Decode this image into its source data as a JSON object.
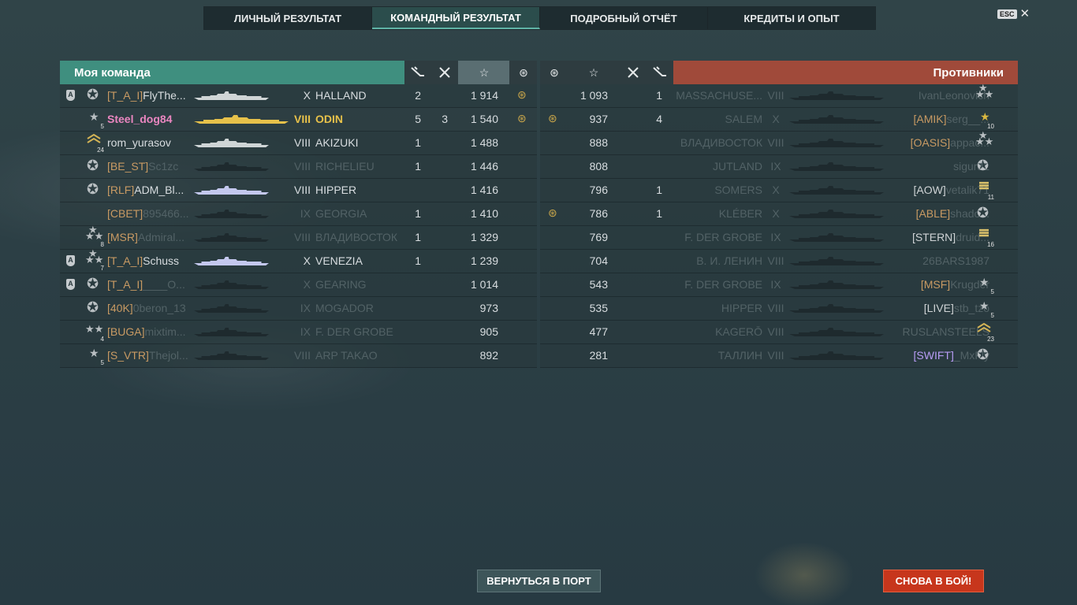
{
  "tabs": [
    "ЛИЧНЫЙ РЕЗУЛЬТАТ",
    "КОМАНДНЫЙ РЕЗУЛЬТАТ",
    "ПОДРОБНЫЙ ОТЧЁТ",
    "КРЕДИТЫ И ОПЫТ"
  ],
  "active_tab": 1,
  "esc": {
    "key": "ESC",
    "close": "✕"
  },
  "my_team": {
    "title": "Моя команда",
    "rows": [
      {
        "a": true,
        "rank": "",
        "rank_style": "big",
        "clan": "[T_A_I]",
        "name": "FlyThe...",
        "tier": "X",
        "ship": "HALLAND",
        "c1": "2",
        "c2": "",
        "xp": "1 914",
        "honor": true,
        "dead": false,
        "sil": "#cfd5d6"
      },
      {
        "a": false,
        "rank": "5",
        "rank_style": "small",
        "clan": "",
        "name": "Steel_dog84",
        "tier": "VIII",
        "ship": "ODIN",
        "c1": "5",
        "c2": "3",
        "xp": "1 540",
        "honor": true,
        "dead": false,
        "me": true,
        "sil": "#e7c14a"
      },
      {
        "a": false,
        "rank": "24",
        "rank_style": "chev",
        "clan": "",
        "name": "rom_yurasov",
        "tier": "VIII",
        "ship": "AKIZUKI",
        "c1": "1",
        "c2": "",
        "xp": "1 488",
        "honor": false,
        "dead": false,
        "sil": "#cfd5d6"
      },
      {
        "a": false,
        "rank": "",
        "rank_style": "big",
        "clan": "[BE_ST]",
        "name": "Sc1zc",
        "tier": "VIII",
        "ship": "RICHELIEU",
        "c1": "1",
        "c2": "",
        "xp": "1 446",
        "honor": false,
        "dead": true,
        "sil": "#1e2a2e"
      },
      {
        "a": false,
        "rank": "",
        "rank_style": "big",
        "clan": "[RLF]",
        "name": "ADM_Bl...",
        "tier": "VIII",
        "ship": "HIPPER",
        "c1": "",
        "c2": "",
        "xp": "1 416",
        "honor": false,
        "dead": false,
        "sil": "#c4c8ee"
      },
      {
        "a": false,
        "rank": "",
        "rank_style": "none",
        "clan": "[CBET]",
        "name": "895466...",
        "tier": "IX",
        "ship": "GEORGIA",
        "c1": "1",
        "c2": "",
        "xp": "1 410",
        "honor": false,
        "dead": true,
        "sil": "#1e2a2e"
      },
      {
        "a": false,
        "rank": "8",
        "rank_style": "multi",
        "clan": "[MSR]",
        "name": "Admiral...",
        "tier": "VIII",
        "ship": "ВЛАДИВОСТОК",
        "c1": "1",
        "c2": "",
        "xp": "1 329",
        "honor": false,
        "dead": true,
        "sil": "#1e2a2e"
      },
      {
        "a": true,
        "rank": "7",
        "rank_style": "multi",
        "clan": "[T_A_I]",
        "name": "Schuss",
        "tier": "X",
        "ship": "VENEZIA",
        "c1": "1",
        "c2": "",
        "xp": "1 239",
        "honor": false,
        "dead": false,
        "sil": "#c4c8ee"
      },
      {
        "a": true,
        "rank": "",
        "rank_style": "big",
        "clan": "[T_A_I]",
        "name": "____O...",
        "tier": "X",
        "ship": "GEARING",
        "c1": "",
        "c2": "",
        "xp": "1 014",
        "honor": false,
        "dead": true,
        "sil": "#1e2a2e"
      },
      {
        "a": false,
        "rank": "",
        "rank_style": "big",
        "clan": "[40K]",
        "name": "0beron_13",
        "tier": "IX",
        "ship": "MOGADOR",
        "c1": "",
        "c2": "",
        "xp": "973",
        "honor": false,
        "dead": true,
        "sil": "#1e2a2e"
      },
      {
        "a": false,
        "rank": "4",
        "rank_style": "two",
        "clan": "[BUGA]",
        "name": "mixtim...",
        "tier": "IX",
        "ship": "F. DER GROBE",
        "c1": "",
        "c2": "",
        "xp": "905",
        "honor": false,
        "dead": true,
        "sil": "#1e2a2e"
      },
      {
        "a": false,
        "rank": "5",
        "rank_style": "small",
        "clan": "[S_VTR]",
        "name": "Thejol...",
        "tier": "VIII",
        "ship": "ARP TAKAO",
        "c1": "",
        "c2": "",
        "xp": "892",
        "honor": false,
        "dead": true,
        "sil": "#1e2a2e"
      }
    ]
  },
  "enemy_team": {
    "title": "Противники",
    "rows": [
      {
        "honor": false,
        "xp": "1 093",
        "c2": "",
        "c1": "1",
        "ship": "MASSACHUSE...",
        "tier": "VIII",
        "clan": "",
        "name": "IvanLeonovich",
        "rank": "",
        "rank_style": "multi",
        "dead": true
      },
      {
        "honor": true,
        "xp": "937",
        "c2": "",
        "c1": "4",
        "ship": "SALEM",
        "tier": "X",
        "clan": "[AMIK]",
        "name": "serg__...",
        "rank": "10",
        "rank_style": "gold",
        "dead": true
      },
      {
        "honor": false,
        "xp": "888",
        "c2": "",
        "c1": "",
        "ship": "ВЛАДИВОСТОК",
        "tier": "VIII",
        "clan": "[OASIS]",
        "name": "appac...",
        "rank": "",
        "rank_style": "multi",
        "dead": true
      },
      {
        "honor": false,
        "xp": "808",
        "c2": "",
        "c1": "",
        "ship": "JUTLAND",
        "tier": "IX",
        "clan": "",
        "name": "sigurd1",
        "rank": "",
        "rank_style": "big",
        "dead": true
      },
      {
        "honor": false,
        "xp": "796",
        "c2": "",
        "c1": "1",
        "ship": "SOMERS",
        "tier": "X",
        "clan": "[AOW]",
        "name": "vetalik71",
        "rank": "11",
        "rank_style": "bar",
        "dead": true
      },
      {
        "honor": true,
        "xp": "786",
        "c2": "",
        "c1": "1",
        "ship": "KLÉBER",
        "tier": "X",
        "clan": "[ABLE]",
        "name": "shado...",
        "rank": "",
        "rank_style": "big",
        "dead": true
      },
      {
        "honor": false,
        "xp": "769",
        "c2": "",
        "c1": "",
        "ship": "F. DER GROBE",
        "tier": "IX",
        "clan": "[STERN]",
        "name": "druid...",
        "rank": "16",
        "rank_style": "bar",
        "dead": true
      },
      {
        "honor": false,
        "xp": "704",
        "c2": "",
        "c1": "",
        "ship": "В. И. ЛЕНИН",
        "tier": "VIII",
        "clan": "",
        "name": "26BARS1987",
        "rank": "",
        "rank_style": "none",
        "dead": true
      },
      {
        "honor": false,
        "xp": "543",
        "c2": "",
        "c1": "",
        "ship": "F. DER GROBE",
        "tier": "IX",
        "clan": "[MSF]",
        "name": "Krugder",
        "rank": "5",
        "rank_style": "small",
        "dead": true
      },
      {
        "honor": false,
        "xp": "535",
        "c2": "",
        "c1": "",
        "ship": "HIPPER",
        "tier": "VIII",
        "clan": "[LIVE]",
        "name": "stb_tzo",
        "rank": "5",
        "rank_style": "small",
        "dead": true
      },
      {
        "honor": false,
        "xp": "477",
        "c2": "",
        "c1": "",
        "ship": "KAGERŌ",
        "tier": "VIII",
        "clan": "",
        "name": "RUSLANSTEELS",
        "rank": "23",
        "rank_style": "chev",
        "dead": true
      },
      {
        "honor": false,
        "xp": "281",
        "c2": "",
        "c1": "",
        "ship": "ТАЛЛИН",
        "tier": "VIII",
        "clan": "[SWIFT]",
        "name": "_MxFly",
        "rank": "",
        "rank_style": "big",
        "dead": true
      }
    ]
  },
  "header_icons": {
    "kills": "kills-icon",
    "planes": "planes-icon",
    "xp": "xp-icon",
    "honor": "honor-icon"
  },
  "buttons": {
    "port": "ВЕРНУТЬСЯ В ПОРТ",
    "battle": "СНОВА В БОЙ!"
  }
}
